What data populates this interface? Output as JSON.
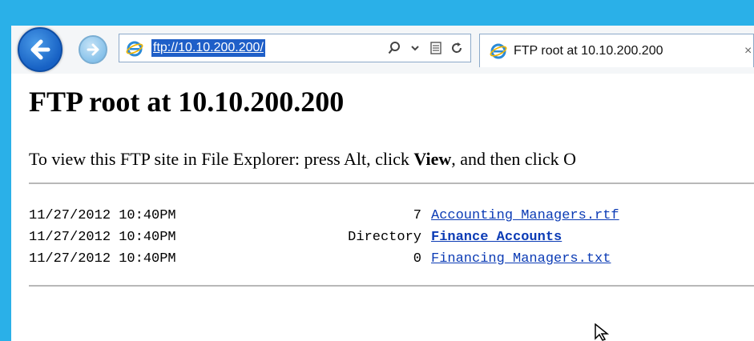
{
  "browser": {
    "address_url": "ftp://10.10.200.200/",
    "tab_title": "FTP root at 10.10.200.200",
    "tab_close_label": "×",
    "accent_color": "#2ab0e8"
  },
  "page": {
    "title": "FTP root at 10.10.200.200",
    "instructions": {
      "part1": "To view this FTP site in File Explorer: press Alt, click ",
      "view": "View",
      "part2": ", and then click O"
    },
    "listing": [
      {
        "date": "11/27/2012 10:40PM",
        "size": "7",
        "name": "Accounting Managers.rtf",
        "is_dir": false
      },
      {
        "date": "11/27/2012 10:40PM",
        "size": "Directory",
        "name": "Finance Accounts",
        "is_dir": true
      },
      {
        "date": "11/27/2012 10:40PM",
        "size": "0",
        "name": "Financing Managers.txt",
        "is_dir": false
      }
    ]
  },
  "icons": [
    "back-arrow-icon",
    "forward-arrow-icon",
    "ie-logo-icon",
    "search-icon",
    "dropdown-arrow-icon",
    "compatibility-view-icon",
    "refresh-icon",
    "close-icon",
    "mouse-cursor-icon"
  ]
}
